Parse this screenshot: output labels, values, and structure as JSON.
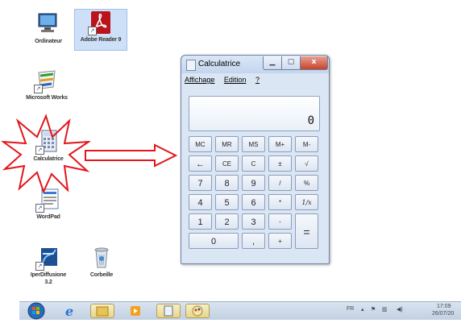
{
  "desktop_icons": [
    {
      "label": "Ordinateur",
      "name": "ordinateur"
    },
    {
      "label": "Adobe Reader 9",
      "name": "adobe-reader"
    },
    {
      "label": "Microsoft Works",
      "name": "microsoft-works"
    },
    {
      "label": "Calculatrice",
      "name": "calculatrice"
    },
    {
      "label": "WordPad",
      "name": "wordpad"
    },
    {
      "label": "IperDiffusione",
      "name": "iperdiffusione"
    },
    {
      "label": "3.2",
      "name": "version"
    },
    {
      "label": "Corbeille",
      "name": "corbeille"
    }
  ],
  "window": {
    "title": "Calculatrice",
    "menu": [
      "Affichage",
      "Edition",
      "?"
    ],
    "display_value": "0",
    "close_glyph": "x"
  },
  "keypad": {
    "row1": [
      "MC",
      "MR",
      "MS",
      "M+",
      "M-"
    ],
    "row2": [
      "←",
      "CE",
      "C",
      "±",
      "√"
    ],
    "row3": [
      "7",
      "8",
      "9",
      "/",
      "%"
    ],
    "row4": [
      "4",
      "5",
      "6",
      "*",
      "1/x"
    ],
    "row5": [
      "1",
      "2",
      "3",
      "-"
    ],
    "row6": [
      "0",
      ",",
      "+"
    ],
    "equals": "="
  },
  "taskbar": {
    "language": "FR",
    "clock_time": "17:09",
    "clock_date": "26/07/20"
  }
}
